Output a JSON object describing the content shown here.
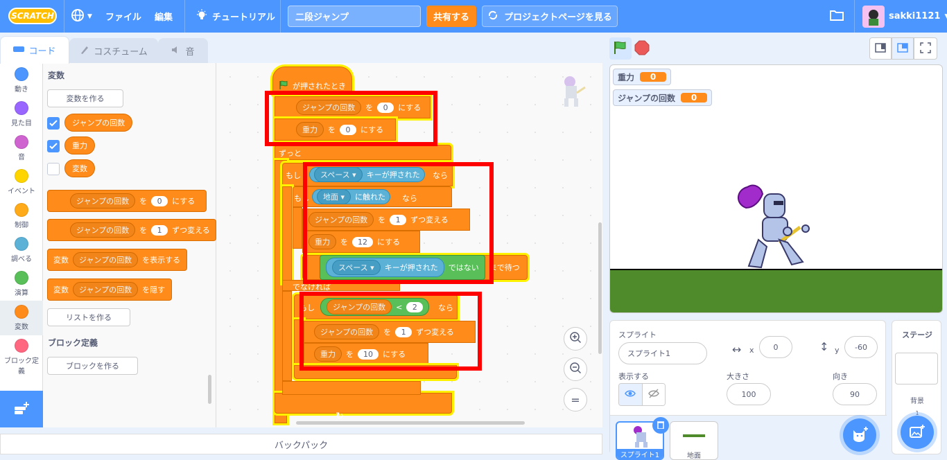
{
  "menu": {
    "logo": "SCRATCH",
    "file": "ファイル",
    "edit": "編集",
    "tutorial": "チュートリアル",
    "project_title": "二段ジャンプ",
    "share": "共有する",
    "project_page": "プロジェクトページを見る",
    "username": "sakki1121"
  },
  "tabs": {
    "code": "コード",
    "costume": "コスチューム",
    "sound": "音"
  },
  "categories": [
    {
      "label": "動き",
      "color": "#4c97ff"
    },
    {
      "label": "見た目",
      "color": "#9966ff"
    },
    {
      "label": "音",
      "color": "#cf63cf"
    },
    {
      "label": "イベント",
      "color": "#ffd500"
    },
    {
      "label": "制御",
      "color": "#ffab19"
    },
    {
      "label": "調べる",
      "color": "#5cb1d6"
    },
    {
      "label": "演算",
      "color": "#59c059"
    },
    {
      "label": "変数",
      "color": "#ff8c1a"
    },
    {
      "label": "ブロック定義",
      "color": "#ff6680"
    }
  ],
  "palette": {
    "heading_vars": "変数",
    "make_var": "変数を作る",
    "var1": "ジャンプの回数",
    "var2": "重力",
    "var3": "変数",
    "set_var": "ジャンプの回数",
    "set_to": "を",
    "set_val": "0",
    "set_suffix": "にする",
    "change_var": "ジャンプの回数",
    "change_to": "を",
    "change_val": "1",
    "change_suffix": "ずつ変える",
    "show_prefix": "変数",
    "show_var": "ジャンプの回数",
    "show_suffix": "を表示する",
    "hide_prefix": "変数",
    "hide_var": "ジャンプの回数",
    "hide_suffix": "を隠す",
    "make_list": "リストを作る",
    "heading_blocks": "ブロック定義",
    "make_block": "ブロックを作る"
  },
  "script": {
    "hat": "が押されたとき",
    "set1_var": "ジャンプの回数",
    "set1_to": "を",
    "set1_val": "0",
    "set1_suffix": "にする",
    "set2_var": "重力",
    "set2_to": "を",
    "set2_val": "0",
    "set2_suffix": "にする",
    "forever": "ずっと",
    "if1": "もし",
    "key_space": "スペース",
    "key_pressed": "キーが押された",
    "then": "なら",
    "if2": "もし",
    "touch_target": "地面",
    "touching": "に触れた",
    "then2": "なら",
    "ch_var": "ジャンプの回数",
    "ch_to": "を",
    "ch_val": "1",
    "ch_suffix": "ずつ変える",
    "grav_var": "重力",
    "grav_to": "を",
    "grav_val": "12",
    "grav_suffix": "にする",
    "key_space2": "スペース",
    "key_pressed2": "キーが押された",
    "not": "ではない",
    "wait_until": "まで待つ",
    "else": "でなければ",
    "if3": "もし",
    "cmp_var": "ジャンプの回数",
    "lt": "<",
    "cmp_val": "2",
    "then3": "なら",
    "ch2_var": "ジャンプの回数",
    "ch2_to": "を",
    "ch2_val": "1",
    "ch2_suffix": "ずつ変える",
    "g2_var": "重力",
    "g2_to": "を",
    "g2_val": "10",
    "g2_suffix": "にする"
  },
  "monitors": {
    "m1_label": "重力",
    "m1_value": "0",
    "m2_label": "ジャンプの回数",
    "m2_value": "0"
  },
  "sprite_info": {
    "label_sprite": "スプライト",
    "name": "スプライト1",
    "x_label": "x",
    "x": "0",
    "y_label": "y",
    "y": "-60",
    "show_label": "表示する",
    "size_label": "大きさ",
    "size": "100",
    "dir_label": "向き",
    "direction": "90",
    "sprite1": "スプライト1",
    "sprite2": "地面"
  },
  "stage_panel": {
    "title": "ステージ",
    "backdrop_label": "背景",
    "backdrop_count": "1"
  },
  "backpack": "バックパック",
  "colors": {
    "menu_blue": "#4c97ff",
    "variables_orange": "#ff8c1a",
    "ground_green": "#4f8a2b",
    "highlight_red": "#ff0000"
  }
}
